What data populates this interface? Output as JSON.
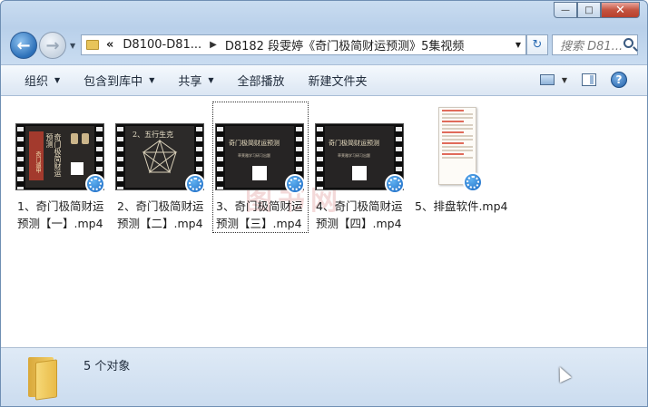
{
  "window": {
    "minimize": "—",
    "maximize": "□",
    "close": "✕"
  },
  "address": {
    "history": "«",
    "crumbs": [
      "D8100-D81...",
      "D8182 段雯婷《奇门极简财运预测》5集视频"
    ],
    "search_placeholder": "搜索 D81..."
  },
  "toolbar": {
    "items": [
      "组织",
      "包含到库中",
      "共享",
      "全部播放",
      "新建文件夹"
    ]
  },
  "files": [
    {
      "name_line1": "1、奇门极简财运",
      "name_line2": "预测【一】.mp4",
      "frame_title": "奇门极简财运预测",
      "frame_sub": "奇门遁甲"
    },
    {
      "name_line1": "2、奇门极简财运",
      "name_line2": "预测【二】.mp4",
      "frame_title": "2、五行生克"
    },
    {
      "name_line1": "3、奇门极简财运",
      "name_line2": "预测【三】.mp4",
      "frame_title": "奇门极简财运预测",
      "frame_sub": "草莱雅学习研习出题"
    },
    {
      "name_line1": "4、奇门极简财运",
      "name_line2": "预测【四】.mp4",
      "frame_title": "奇门极简财运预测",
      "frame_sub": "草莱雅学习研习出题"
    },
    {
      "name_line1": "5、排盘软件.mp4",
      "name_line2": ""
    }
  ],
  "status": {
    "count": "5 个对象"
  },
  "colors": {
    "accent": "#2b6fb8",
    "frame_bg": "#c9dcf0",
    "selection_border": "#333333"
  }
}
